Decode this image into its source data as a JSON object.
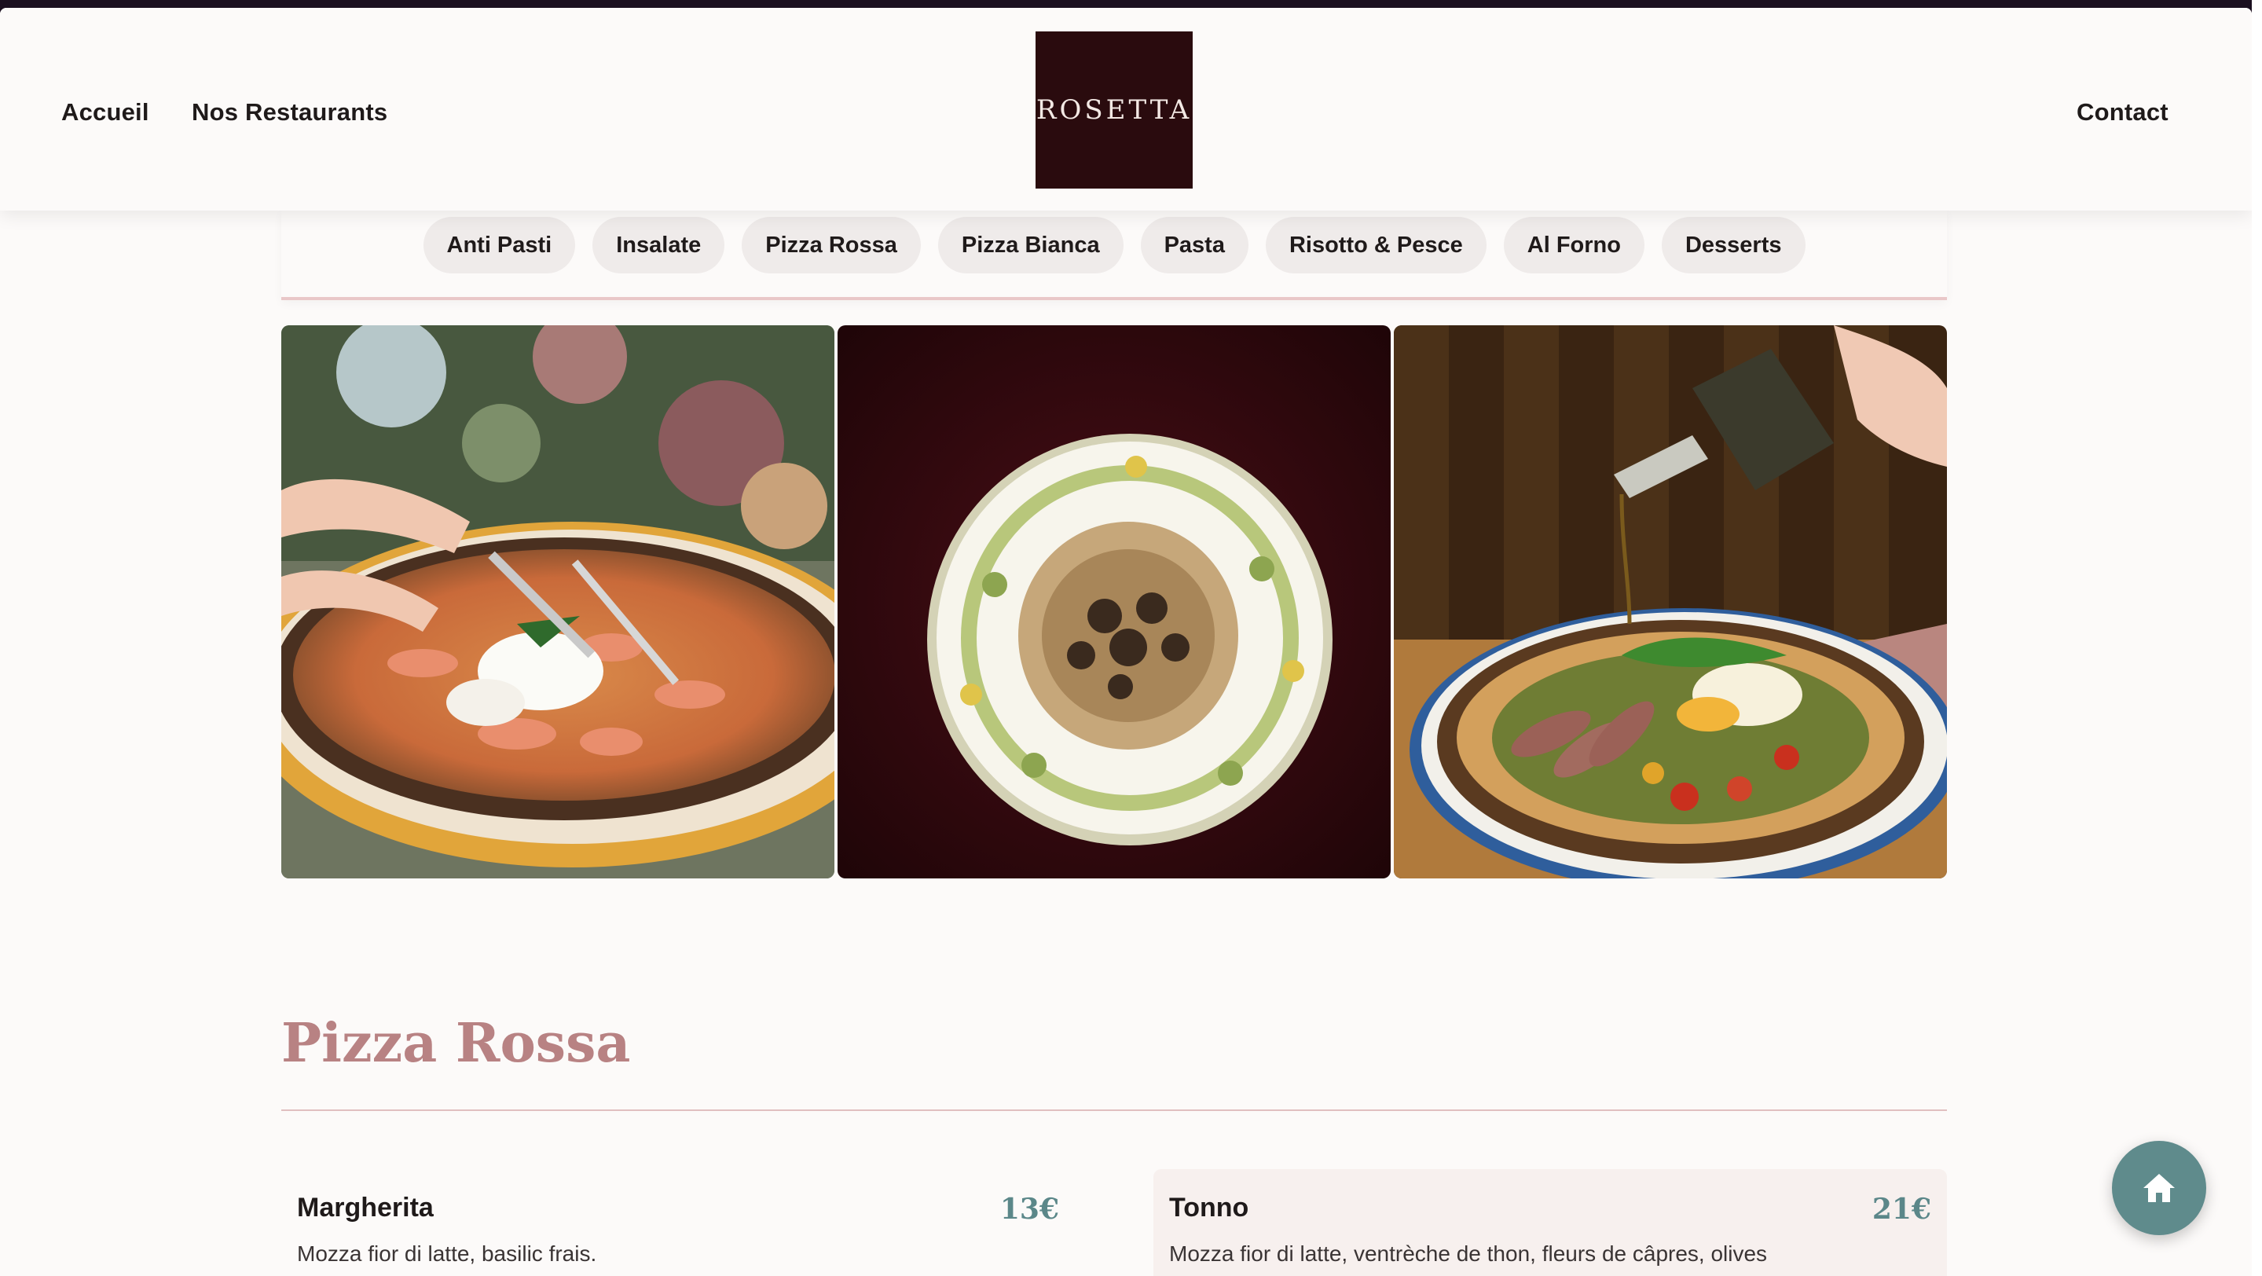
{
  "nav": {
    "home": "Accueil",
    "restaurants": "Nos Restaurants",
    "contact": "Contact",
    "logo_text": "ROSETTA"
  },
  "categories": [
    "Anti Pasti",
    "Insalate",
    "Pizza Rossa",
    "Pizza Bianca",
    "Pasta",
    "Risotto & Pesce",
    "Al Forno",
    "Desserts"
  ],
  "gallery": [
    {
      "icon": "pizza-burrata-photo"
    },
    {
      "icon": "truffle-pasta-photo"
    },
    {
      "icon": "pizza-olive-oil-photo"
    }
  ],
  "section": {
    "title": "Pizza Rossa",
    "items": [
      {
        "name": "Margherita",
        "price": "13€",
        "desc": "Mozza fior di latte, basilic frais."
      },
      {
        "name": "Tonno",
        "price": "21€",
        "desc": "Mozza fior di latte, ventrèche de thon, fleurs de câpres, olives"
      }
    ]
  },
  "colors": {
    "accent_title": "#b88283",
    "price": "#5b8789",
    "logo_bg": "#2a0b0e",
    "fab": "#5f8b8c"
  },
  "fab_icon": "home-icon"
}
